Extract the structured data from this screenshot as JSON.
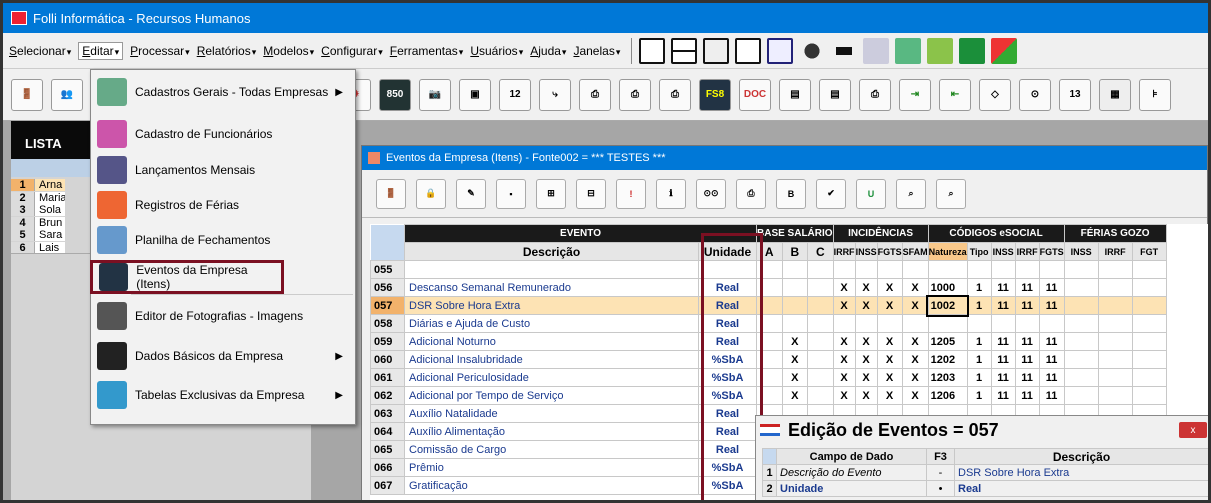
{
  "window": {
    "title": "Folli Informática - Recursos Humanos"
  },
  "menu": [
    {
      "label": "Selecionar",
      "u": "S",
      "rest": "elecionar"
    },
    {
      "label": "Editar",
      "u": "E",
      "rest": "ditar"
    },
    {
      "label": "Processar",
      "u": "P",
      "rest": "rocessar"
    },
    {
      "label": "Relatórios",
      "u": "R",
      "rest": "elatórios"
    },
    {
      "label": "Modelos",
      "u": "M",
      "rest": "odelos"
    },
    {
      "label": "Configurar",
      "u": "C",
      "rest": "onfigurar"
    },
    {
      "label": "Ferramentas",
      "u": "F",
      "rest": "erramentas"
    },
    {
      "label": "Usuários",
      "u": "U",
      "rest": "suários"
    },
    {
      "label": "Ajuda",
      "u": "A",
      "rest": "juda"
    },
    {
      "label": "Janelas",
      "u": "J",
      "rest": "anelas"
    }
  ],
  "dropdown": [
    {
      "label": "Cadastros Gerais - Todas Empresas",
      "icon": "cadastros-gerais-icon",
      "submenu": true
    },
    {
      "label": "Cadastro de Funcionários",
      "icon": "funcionarios-icon",
      "submenu": false
    },
    {
      "label": "Lançamentos Mensais",
      "icon": "lancamentos-icon",
      "submenu": false
    },
    {
      "label": "Registros de Férias",
      "icon": "ferias-icon",
      "submenu": false
    },
    {
      "label": "Planilha de Fechamentos",
      "icon": "planilha-icon",
      "submenu": false
    },
    {
      "label": "Eventos da Empresa (Itens)",
      "icon": "eventos-icon",
      "submenu": false
    },
    {
      "label": "Editor de Fotografias - Imagens",
      "icon": "camera-icon",
      "submenu": false
    },
    {
      "label": "Dados Básicos da Empresa",
      "icon": "dados-basicos-icon",
      "submenu": true
    },
    {
      "label": "Tabelas Exclusivas da Empresa",
      "icon": "tabelas-icon",
      "submenu": true
    }
  ],
  "lista": {
    "title": "LISTA",
    "rows": [
      {
        "n": "1",
        "v": "Arna"
      },
      {
        "n": "2",
        "v": "Maria"
      },
      {
        "n": "3",
        "v": "Sola"
      },
      {
        "n": "4",
        "v": "Brun"
      },
      {
        "n": "5",
        "v": "Sara"
      },
      {
        "n": "6",
        "v": "Lais"
      }
    ]
  },
  "eventos": {
    "title": "Eventos da Empresa (Itens) - Fonte002 = *** TESTES ***",
    "group_headers": {
      "evento": "EVENTO",
      "base": "BASE SALÁRIO",
      "inc": "INCIDÊNCIAS",
      "esocial": "CÓDIGOS eSOCIAL",
      "ferias": "FÉRIAS GOZO"
    },
    "col_headers": {
      "descricao": "Descrição",
      "unidade": "Unidade",
      "a": "A",
      "b": "B",
      "c": "C",
      "irrf": "IRRF",
      "inss": "INSS",
      "fgts": "FGTS",
      "sfam": "SFAM",
      "natureza": "Natureza",
      "tipo": "Tipo",
      "einss": "INSS",
      "eirrf": "IRRF",
      "efgts": "FGTS",
      "finss": "INSS",
      "firrf": "IRRF",
      "ffgt": "FGT"
    },
    "rows": [
      {
        "n": "055",
        "d": "",
        "u": "",
        "a": "",
        "b": "",
        "c": "",
        "i1": "",
        "i2": "",
        "i3": "",
        "i4": "",
        "nat": "",
        "tipo": "",
        "e1": "",
        "e2": "",
        "e3": ""
      },
      {
        "n": "056",
        "d": "Descanso Semanal Remunerado",
        "u": "Real",
        "a": "",
        "b": "",
        "c": "",
        "i1": "X",
        "i2": "X",
        "i3": "X",
        "i4": "X",
        "nat": "1000",
        "tipo": "1",
        "e1": "11",
        "e2": "11",
        "e3": "11"
      },
      {
        "n": "057",
        "d": "DSR Sobre Hora Extra",
        "u": "Real",
        "a": "",
        "b": "",
        "c": "",
        "i1": "X",
        "i2": "X",
        "i3": "X",
        "i4": "X",
        "nat": "1002",
        "tipo": "1",
        "e1": "11",
        "e2": "11",
        "e3": "11"
      },
      {
        "n": "058",
        "d": "Diárias e Ajuda de Custo",
        "u": "Real",
        "a": "",
        "b": "",
        "c": "",
        "i1": "",
        "i2": "",
        "i3": "",
        "i4": "",
        "nat": "",
        "tipo": "",
        "e1": "",
        "e2": "",
        "e3": ""
      },
      {
        "n": "059",
        "d": "Adicional Noturno",
        "u": "Real",
        "a": "",
        "b": "X",
        "c": "",
        "i1": "X",
        "i2": "X",
        "i3": "X",
        "i4": "X",
        "nat": "1205",
        "tipo": "1",
        "e1": "11",
        "e2": "11",
        "e3": "11"
      },
      {
        "n": "060",
        "d": "Adicional Insalubridade",
        "u": "%SbA",
        "a": "",
        "b": "X",
        "c": "",
        "i1": "X",
        "i2": "X",
        "i3": "X",
        "i4": "X",
        "nat": "1202",
        "tipo": "1",
        "e1": "11",
        "e2": "11",
        "e3": "11"
      },
      {
        "n": "061",
        "d": "Adicional Periculosidade",
        "u": "%SbA",
        "a": "",
        "b": "X",
        "c": "",
        "i1": "X",
        "i2": "X",
        "i3": "X",
        "i4": "X",
        "nat": "1203",
        "tipo": "1",
        "e1": "11",
        "e2": "11",
        "e3": "11"
      },
      {
        "n": "062",
        "d": "Adicional por Tempo de Serviço",
        "u": "%SbA",
        "a": "",
        "b": "X",
        "c": "",
        "i1": "X",
        "i2": "X",
        "i3": "X",
        "i4": "X",
        "nat": "1206",
        "tipo": "1",
        "e1": "11",
        "e2": "11",
        "e3": "11"
      },
      {
        "n": "063",
        "d": "Auxílio Natalidade",
        "u": "Real",
        "a": "",
        "b": "",
        "c": "",
        "i1": "",
        "i2": "",
        "i3": "",
        "i4": "",
        "nat": "",
        "tipo": "",
        "e1": "",
        "e2": "",
        "e3": ""
      },
      {
        "n": "064",
        "d": "Auxílio Alimentação",
        "u": "Real",
        "a": "",
        "b": "",
        "c": "",
        "i1": "",
        "i2": "",
        "i3": "",
        "i4": "",
        "nat": "",
        "tipo": "",
        "e1": "",
        "e2": "",
        "e3": ""
      },
      {
        "n": "065",
        "d": "Comissão de Cargo",
        "u": "Real",
        "a": "",
        "b": "",
        "c": "",
        "i1": "",
        "i2": "",
        "i3": "",
        "i4": "",
        "nat": "",
        "tipo": "",
        "e1": "",
        "e2": "",
        "e3": ""
      },
      {
        "n": "066",
        "d": "Prêmio",
        "u": "%SbA",
        "a": "",
        "b": "",
        "c": "",
        "i1": "",
        "i2": "",
        "i3": "",
        "i4": "",
        "nat": "",
        "tipo": "",
        "e1": "",
        "e2": "",
        "e3": ""
      },
      {
        "n": "067",
        "d": "Gratificação",
        "u": "%SbA",
        "a": "",
        "b": "",
        "c": "",
        "i1": "",
        "i2": "",
        "i3": "",
        "i4": "",
        "nat": "",
        "tipo": "",
        "e1": "",
        "e2": "",
        "e3": ""
      }
    ],
    "selected_row": "057"
  },
  "edicao": {
    "title": "Edição de Eventos = 057",
    "headers": {
      "campo": "Campo de Dado",
      "f3": "F3",
      "desc": "Descrição"
    },
    "rows": [
      {
        "n": "1",
        "campo": "Descrição do Evento",
        "f3": "-",
        "desc": "DSR Sobre Hora Extra"
      },
      {
        "n": "2",
        "campo": "Unidade",
        "f3": "•",
        "desc": "Real"
      }
    ],
    "close": "x"
  },
  "colors": {
    "titlebar": "#0078d7",
    "highlight_border": "#7b1022",
    "link_text": "#1a3a8f",
    "selected_row": "#fde3b4"
  }
}
